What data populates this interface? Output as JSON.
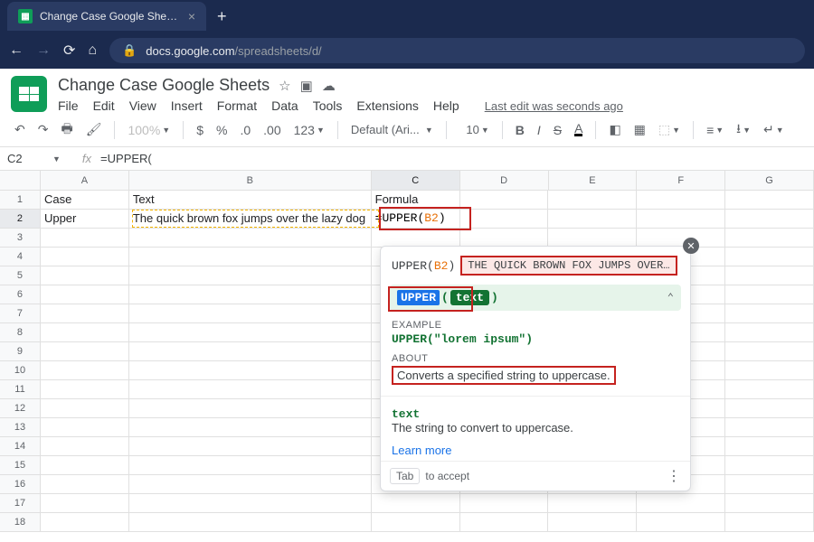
{
  "browser": {
    "tab_title": "Change Case Google Sheets - Go",
    "url_domain": "docs.google.com",
    "url_path": "/spreadsheets/d/"
  },
  "doc": {
    "title": "Change Case Google Sheets",
    "menus": [
      "File",
      "Edit",
      "View",
      "Insert",
      "Format",
      "Data",
      "Tools",
      "Extensions",
      "Help"
    ],
    "last_edit": "Last edit was seconds ago"
  },
  "toolbar": {
    "zoom": "100%",
    "font": "Default (Ari...",
    "font_size": "10",
    "num_format": "123"
  },
  "fx": {
    "name_box": "C2",
    "formula": "=UPPER("
  },
  "grid": {
    "cols": [
      "A",
      "B",
      "C",
      "D",
      "E",
      "F",
      "G"
    ],
    "rows": 18,
    "active_col": "C",
    "active_row": 2,
    "cells": {
      "A1": "Case",
      "B1": "Text",
      "C1": "Formula",
      "A2": "Upper",
      "B2": "The quick brown fox jumps over the lazy dog",
      "C2_prefix": "=UPPER(",
      "C2_arg": "B2",
      "C2_suffix": ")"
    }
  },
  "popup": {
    "fn": "UPPER",
    "arg_ref": "B2",
    "preview": "THE QUICK BROWN FOX JUMPS OVER THE...",
    "sig_fn": "UPPER",
    "sig_arg": "text",
    "example_label": "EXAMPLE",
    "example": "UPPER(\"lorem ipsum\")",
    "about_label": "ABOUT",
    "about": "Converts a specified string to uppercase.",
    "arg_name": "text",
    "arg_desc": "The string to convert to uppercase.",
    "learn": "Learn more",
    "tab_key": "Tab",
    "accept": "to accept"
  }
}
